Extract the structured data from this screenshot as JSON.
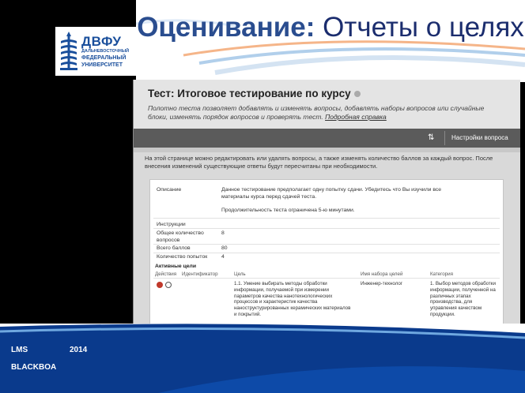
{
  "slide": {
    "title_strong": "Оценивание:",
    "title_rest": " Отчеты о целях",
    "logo": {
      "abbr": "ДВФУ",
      "line1": "ДАЛЬНЕВОСТОЧНЫЙ",
      "line2": "ФЕДЕРАЛЬНЫЙ",
      "line3": "УНИВЕРСИТЕТ"
    },
    "footer": {
      "lms": "LMS",
      "year": "2014",
      "brand": "BLACKBOA"
    }
  },
  "screen": {
    "test_title": "Тест: Итоговое тестирование по курсу",
    "description": "Полотно теста позволяет добавлять и изменять вопросы, добавлять наборы вопросов или случайные блоки, изменять порядок вопросов и проверять тест.",
    "help_link": "Подробная справка",
    "toolbar": {
      "settings_label": "Настройки вопроса"
    },
    "notice": "На этой странице можно редактировать или удалять вопросы, а также изменять количество баллов за каждый вопрос. После внесения изменений существующие ответы будут пересчитаны при необходимости.",
    "details": {
      "description_label": "Описание",
      "description_value": "Данное тестирование предполагает одну попытку сдачи. Убедитесь что Вы изучили все материалы курса перед сдачей теста.",
      "duration_note": "Продолжительность теста ограничена 5-ю минутами.",
      "instructions_label": "Инструкции",
      "questions_label": "Общее количество вопросов",
      "questions_value": "8",
      "points_label": "Всего баллов",
      "points_value": "80",
      "attempts_label": "Количество попыток",
      "attempts_value": "4"
    },
    "goals": {
      "title": "Активные цели",
      "headers": [
        "Действия",
        "Идентификатор",
        "Цель",
        "Имя набора целей",
        "Категория"
      ],
      "row": {
        "goal": "1.1. Умение выбирать методы обработки информации, получаемой при измерении параметров качества нанотехнологических процессов и характеристик качества наноструктурированных керамических материалов и покрытий.",
        "goal_set": "Инженер-технолог",
        "category": "1. Выбор методов обработки информации, полученной на различных этапах производства, для управления качеством продукции."
      }
    }
  }
}
